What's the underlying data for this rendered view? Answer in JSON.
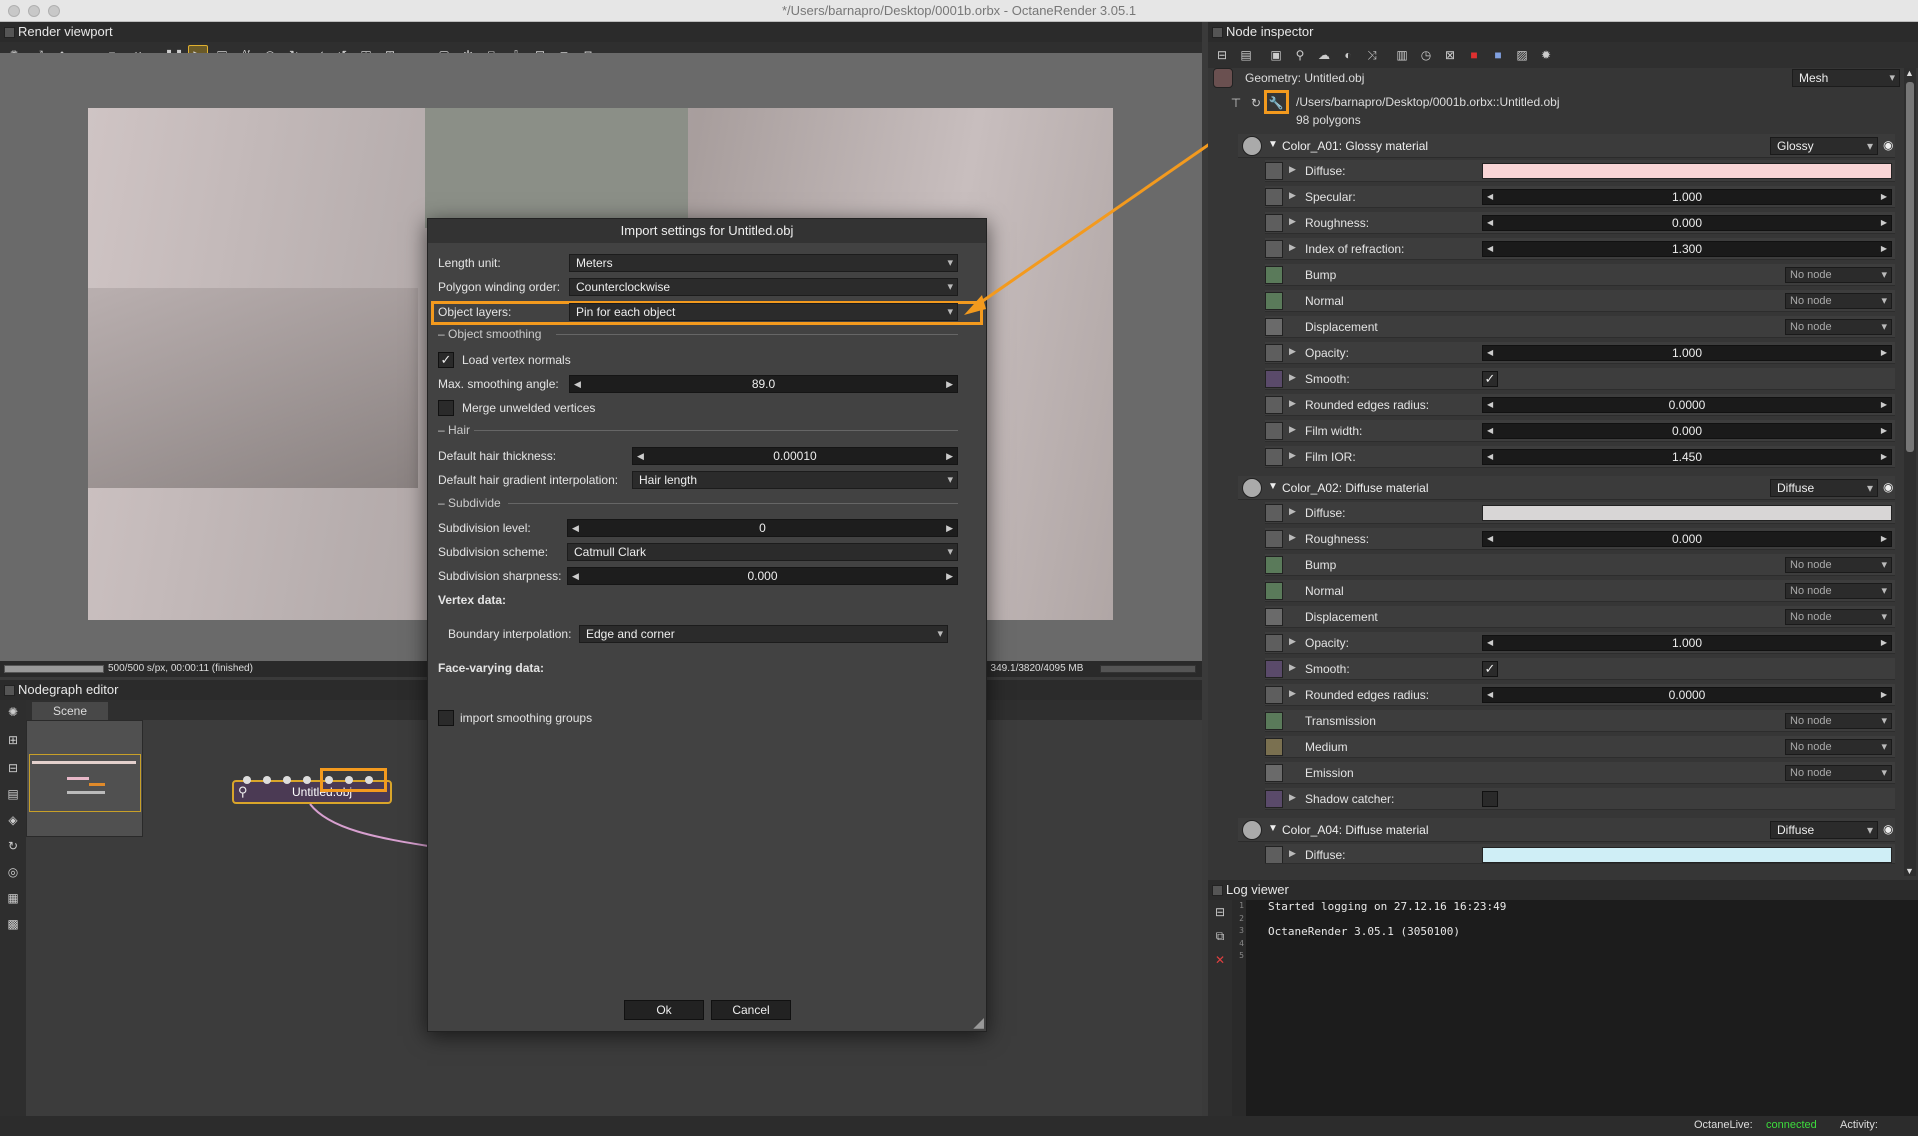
{
  "window": {
    "title": "*/Users/barnapro/Desktop/0001b.orbx - OctaneRender 3.05.1"
  },
  "viewport": {
    "header": "Render viewport",
    "status_left": "500/500 s/px, 00:00:11 (finished)",
    "status_right": ", 349.1/3820/4095 MB"
  },
  "nodegraph": {
    "header": "Nodegraph editor",
    "tab": "Scene",
    "node_label": "Untitled.obj"
  },
  "dialog": {
    "title": "Import settings for Untitled.obj",
    "length_unit_label": "Length unit:",
    "length_unit_value": "Meters",
    "winding_label": "Polygon winding order:",
    "winding_value": "Counterclockwise",
    "layers_label": "Object layers:",
    "layers_value": "Pin for each object",
    "smoothing_section": "Object smoothing",
    "load_normals_label": "Load vertex normals",
    "max_angle_label": "Max. smoothing angle:",
    "max_angle_value": "89.0",
    "merge_label": "Merge unwelded vertices",
    "hair_section": "Hair",
    "hair_thickness_label": "Default hair thickness:",
    "hair_thickness_value": "0.00010",
    "hair_gradient_label": "Default hair gradient interpolation:",
    "hair_gradient_value": "Hair length",
    "subdivide_section": "Subdivide",
    "subdiv_level_label": "Subdivision level:",
    "subdiv_level_value": "0",
    "subdiv_scheme_label": "Subdivision scheme:",
    "subdiv_scheme_value": "Catmull Clark",
    "subdiv_sharp_label": "Subdivision sharpness:",
    "subdiv_sharp_value": "0.000",
    "vertex_data_label": "Vertex data:",
    "boundary_label": "Boundary interpolation:",
    "boundary_value": "Edge and corner",
    "face_varying_label": "Face-varying data:",
    "import_groups_label": "import smoothing groups",
    "ok_label": "Ok",
    "cancel_label": "Cancel"
  },
  "inspector": {
    "header": "Node inspector",
    "geometry_label": "Geometry: Untitled.obj",
    "geometry_type": "Mesh",
    "path": "/Users/barnapro/Desktop/0001b.orbx::Untitled.obj",
    "polygons": "98 polygons",
    "no_node": "No node",
    "materials": [
      {
        "name": "Color_A01: Glossy material",
        "type": "Glossy"
      },
      {
        "name": "Color_A02: Diffuse material",
        "type": "Diffuse"
      },
      {
        "name": "Color_A04: Diffuse material",
        "type": "Diffuse"
      }
    ],
    "m1": {
      "diffuse": "Diffuse:",
      "specular": "Specular:",
      "specular_v": "1.000",
      "roughness": "Roughness:",
      "roughness_v": "0.000",
      "ior": "Index of refraction:",
      "ior_v": "1.300",
      "bump": "Bump",
      "normal": "Normal",
      "displacement": "Displacement",
      "opacity": "Opacity:",
      "opacity_v": "1.000",
      "smooth": "Smooth:",
      "rounded": "Rounded edges radius:",
      "rounded_v": "0.0000",
      "film_width": "Film width:",
      "film_width_v": "0.000",
      "film_ior": "Film IOR:",
      "film_ior_v": "1.450"
    },
    "m2": {
      "diffuse": "Diffuse:",
      "roughness": "Roughness:",
      "roughness_v": "0.000",
      "bump": "Bump",
      "normal": "Normal",
      "displacement": "Displacement",
      "opacity": "Opacity:",
      "opacity_v": "1.000",
      "smooth": "Smooth:",
      "rounded": "Rounded edges radius:",
      "rounded_v": "0.0000",
      "transmission": "Transmission",
      "medium": "Medium",
      "emission": "Emission",
      "shadow": "Shadow catcher:"
    },
    "m3": {
      "diffuse": "Diffuse:"
    }
  },
  "log": {
    "header": "Log viewer",
    "lines": [
      "Started logging on 27.12.16 16:23:49",
      "",
      "OctaneRender 3.05.1 (3050100)",
      "",
      ""
    ]
  },
  "footer": {
    "octanelive_label": "OctaneLive:",
    "octanelive_status": "connected",
    "activity_label": "Activity:"
  },
  "colors": {
    "accent_orange": "#f39a1e",
    "connected_green": "#3ddc3d",
    "diffuse_pink": "#f9d5d6",
    "diffuse_grey": "#d8d6d6",
    "diffuse_blue": "#cfeef6"
  }
}
